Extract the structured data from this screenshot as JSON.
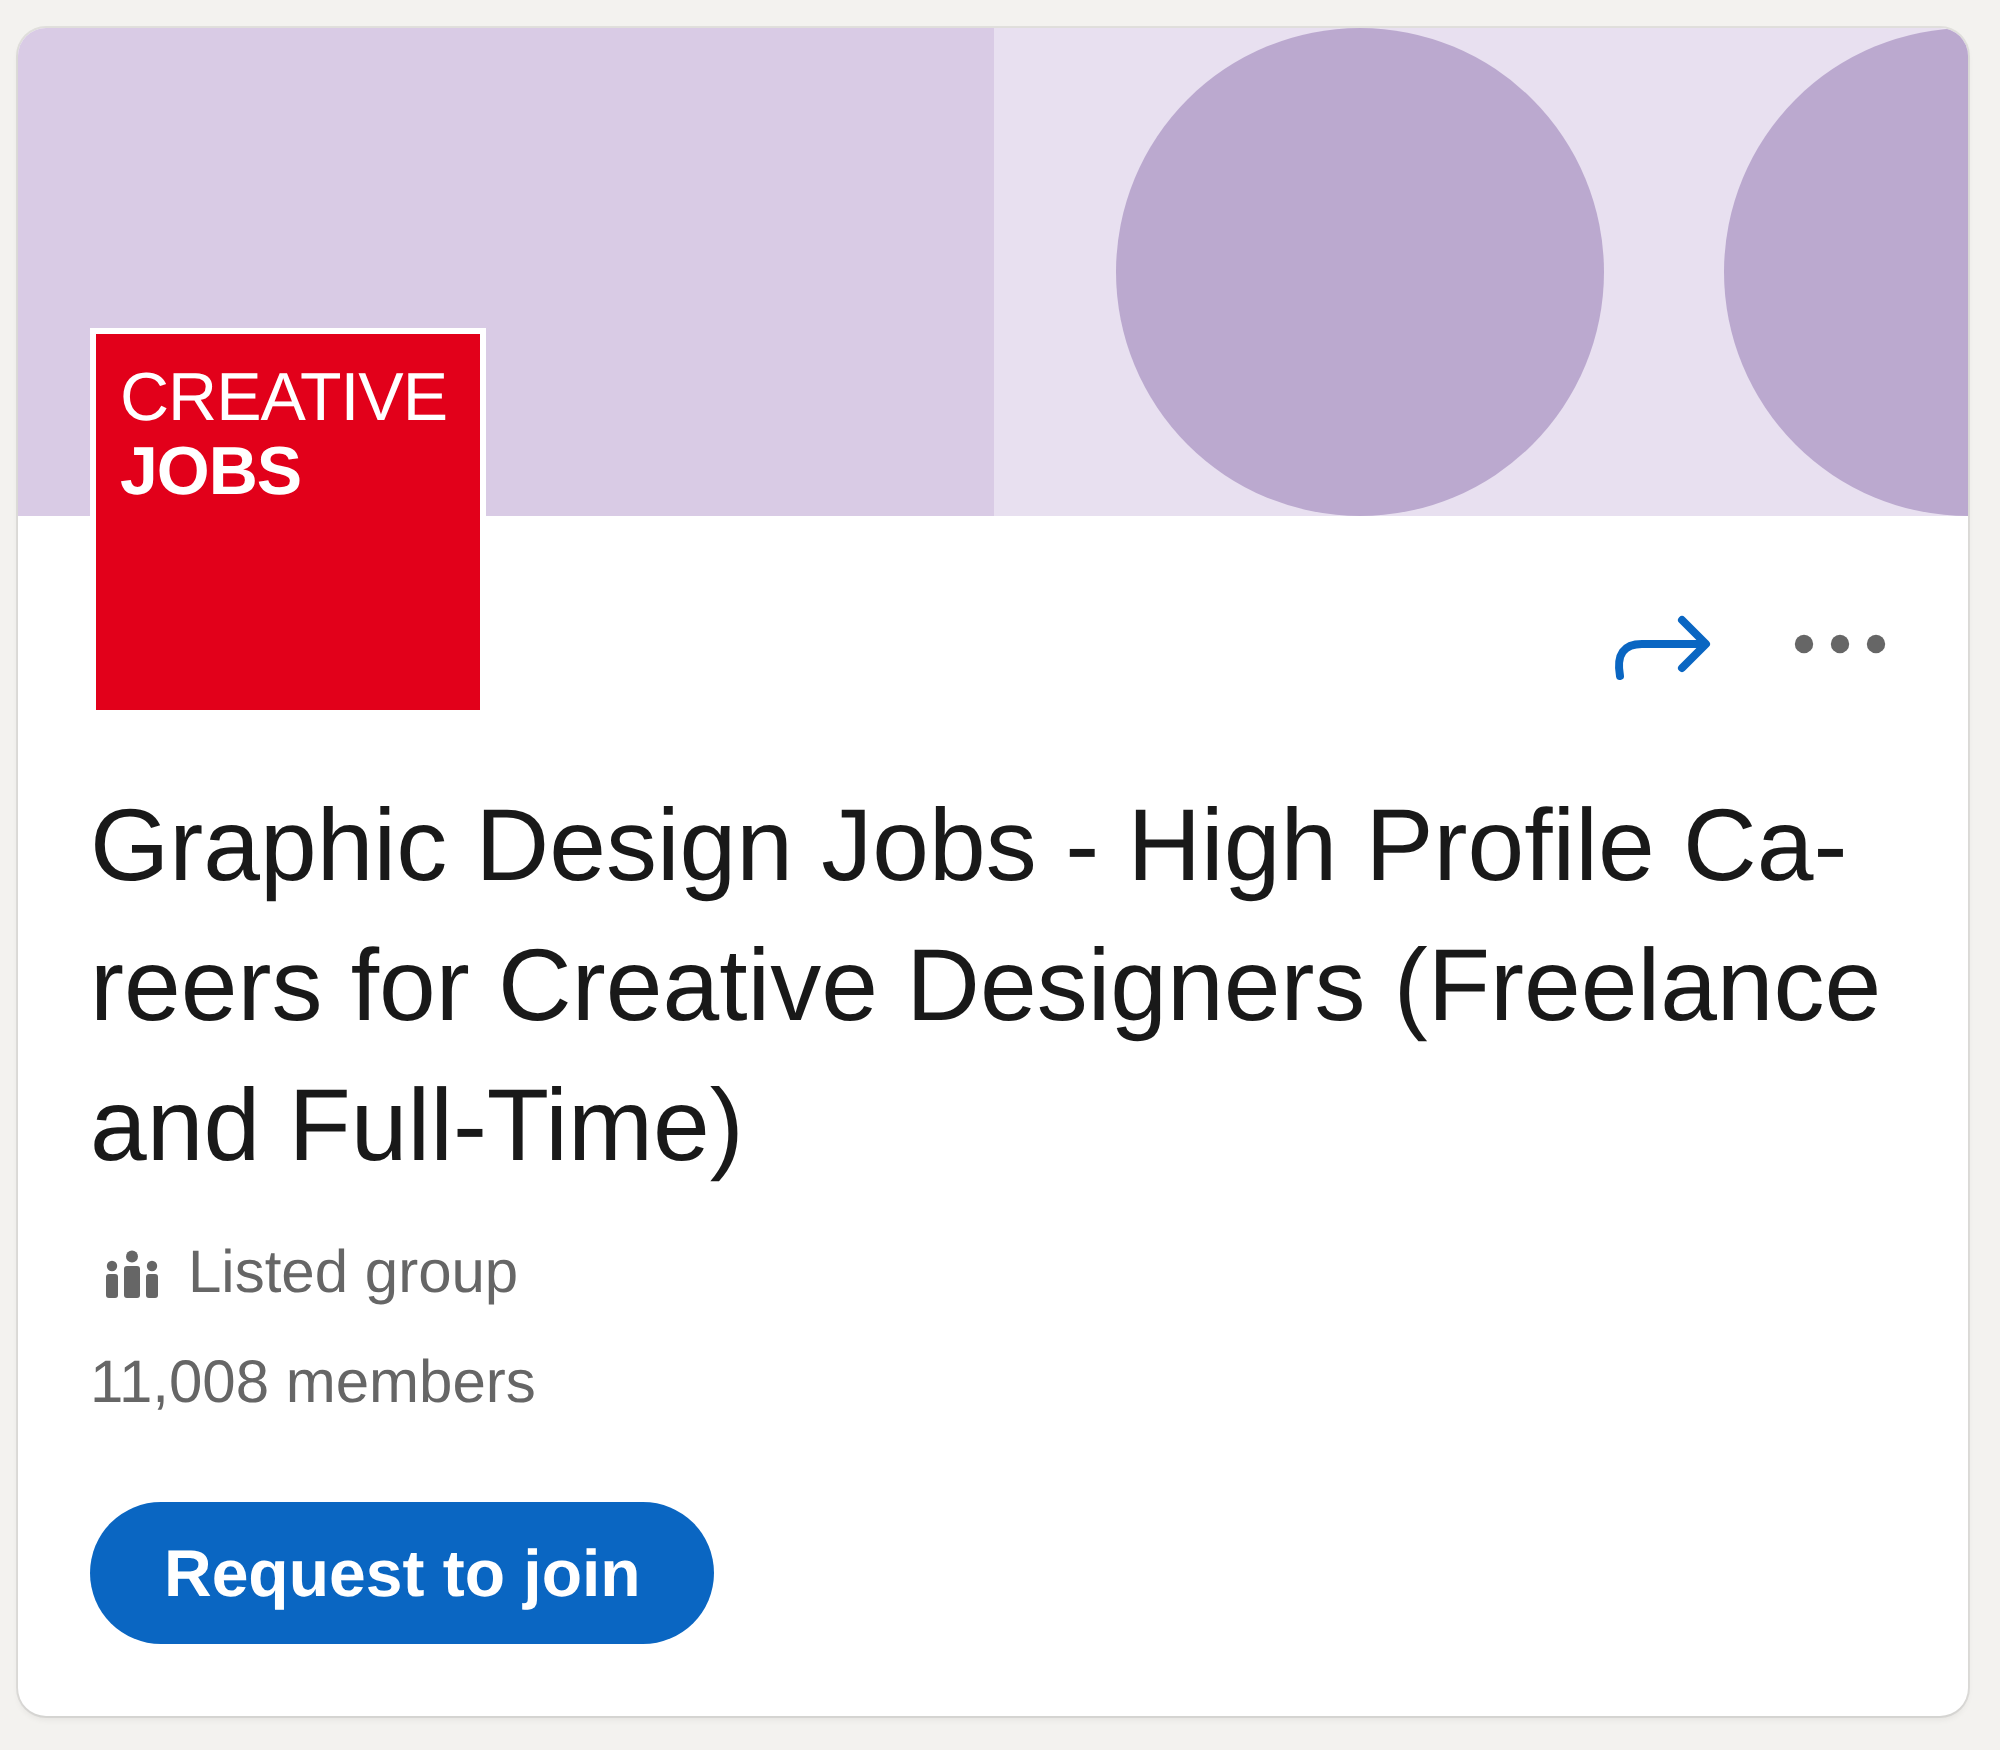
{
  "card": {
    "logo": {
      "lines": [
        {
          "text": "CREATIVE",
          "bold": false
        },
        {
          "text": "JOBS",
          "bold": true
        }
      ]
    },
    "title": "Graphic Design Jobs - High Profile Ca-reers for Creative Designers (Freelance and Full-Time)",
    "visibility": "Listed group",
    "members": "11,008 members",
    "join_button": {
      "label": "Request to join"
    }
  }
}
